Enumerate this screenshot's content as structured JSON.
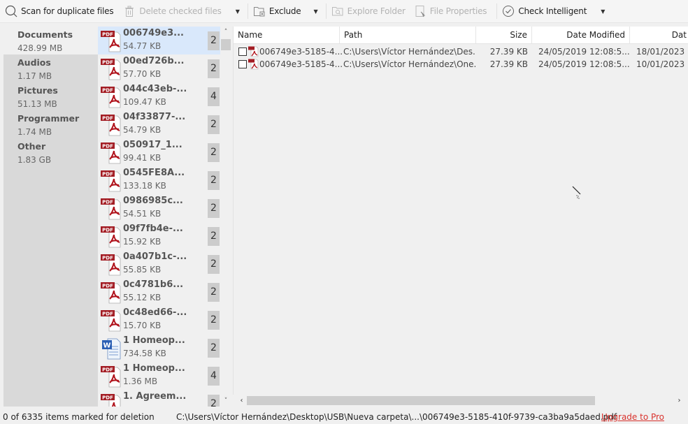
{
  "toolbar": {
    "scan": {
      "label": "Scan for duplicate files",
      "icon": "search-icon"
    },
    "delete": {
      "label": "Delete checked files",
      "icon": "trash-icon",
      "enabled": false
    },
    "exclude": {
      "label": "Exclude",
      "icon": "folder-exclude-icon"
    },
    "explore": {
      "label": "Explore Folder",
      "icon": "explore-folder-icon",
      "enabled": false
    },
    "properties": {
      "label": "File Properties",
      "icon": "file-properties-icon",
      "enabled": false
    },
    "check": {
      "label": "Check Intelligent",
      "icon": "check-circle-icon"
    }
  },
  "categories": [
    {
      "name": "Documents",
      "size": "428.99 MB",
      "active": true
    },
    {
      "name": "Audios",
      "size": "1.17 MB"
    },
    {
      "name": "Pictures",
      "size": "51.13 MB"
    },
    {
      "name": "Programmer",
      "size": "1.74 MB"
    },
    {
      "name": "Other",
      "size": "1.83 GB"
    }
  ],
  "files": [
    {
      "name": "006749e3...",
      "size": "54.77 KB",
      "count": "2",
      "type": "pdf",
      "selected": true
    },
    {
      "name": "00ed726b...",
      "size": "57.70 KB",
      "count": "2",
      "type": "pdf"
    },
    {
      "name": "044c43eb-...",
      "size": "109.47 KB",
      "count": "4",
      "type": "pdf"
    },
    {
      "name": "04f33877-...",
      "size": "54.79 KB",
      "count": "2",
      "type": "pdf"
    },
    {
      "name": "050917_1...",
      "size": "99.41 KB",
      "count": "2",
      "type": "pdf"
    },
    {
      "name": "0545FE8A...",
      "size": "133.18 KB",
      "count": "2",
      "type": "pdf"
    },
    {
      "name": "0986985c...",
      "size": "54.51 KB",
      "count": "2",
      "type": "pdf"
    },
    {
      "name": "09f7fb4e-...",
      "size": "15.92 KB",
      "count": "2",
      "type": "pdf"
    },
    {
      "name": "0a407b1c-...",
      "size": "55.85 KB",
      "count": "2",
      "type": "pdf"
    },
    {
      "name": "0c4781b6...",
      "size": "55.12 KB",
      "count": "2",
      "type": "pdf"
    },
    {
      "name": "0c48ed66-...",
      "size": "15.70 KB",
      "count": "2",
      "type": "pdf"
    },
    {
      "name": "1 Homeop...",
      "size": "734.58 KB",
      "count": "2",
      "type": "word"
    },
    {
      "name": "1 Homeop...",
      "size": "1.36 MB",
      "count": "4",
      "type": "pdf"
    },
    {
      "name": "1. Agreem...",
      "size": "",
      "count": "2",
      "type": "pdf"
    }
  ],
  "grid": {
    "columns": [
      "Name",
      "Path",
      "Size",
      "Date Modified",
      "Dat"
    ],
    "rows": [
      {
        "checked": false,
        "name": "006749e3-5185-4...",
        "path": "C:\\Users\\Víctor Hernández\\Des...",
        "size": "27.39 KB",
        "modified": "24/05/2019 12:08:5...",
        "date2": "18/01/2023"
      },
      {
        "checked": false,
        "name": "006749e3-5185-4...",
        "path": "C:\\Users\\Víctor Hernández\\One...",
        "size": "27.39 KB",
        "modified": "24/05/2019 12:08:5...",
        "date2": "10/01/2023"
      }
    ]
  },
  "status": {
    "marked": "0 of 6335 items marked for deletion",
    "path": "C:\\Users\\Víctor Hernández\\Desktop\\USB\\Nueva carpeta\\...\\006749e3-5185-410f-9739-ca3ba9a5daed.pdf",
    "upgrade": "Upgrade to Pro"
  },
  "colors": {
    "selection": "#d9e8fb",
    "pdf_red": "#a31d24",
    "upgrade_link": "#d9322d"
  }
}
